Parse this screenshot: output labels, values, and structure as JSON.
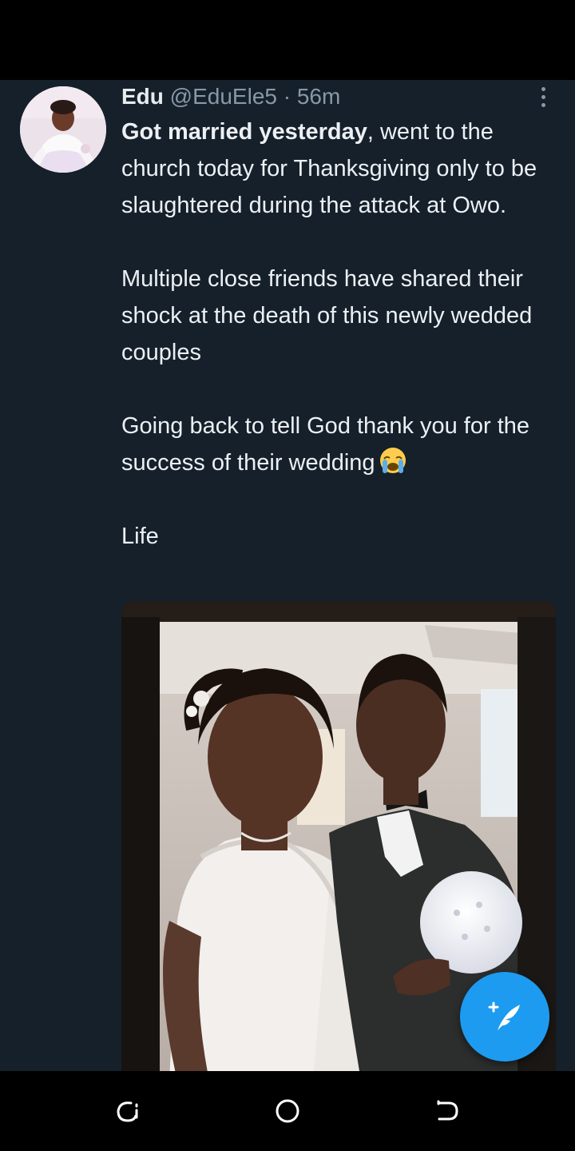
{
  "tweet": {
    "author_name": "Edu",
    "author_handle": "@EduEle5",
    "separator": "·",
    "time": "56m",
    "text_bold": "Got married yesterday",
    "text_line1_rest": ", went to the church today for Thanksgiving only to be slaughtered during the attack  at Owo.",
    "paragraph2": "Multiple close friends have shared their shock at the death of this newly wedded couples",
    "paragraph3": "Going back to tell God thank you for the success of their wedding",
    "paragraph3_emoji": "loudly-crying-face-emoji",
    "paragraph4": "Life"
  },
  "icons": {
    "more": "more-vertical-icon",
    "compose": "compose-tweet-icon",
    "nav_recent": "recent-apps-icon",
    "nav_home": "home-icon",
    "nav_back": "back-icon"
  },
  "colors": {
    "background": "#15202b",
    "accent": "#1d9bf0",
    "secondary_text": "#8899a6",
    "primary_text": "#ecf0f3"
  }
}
